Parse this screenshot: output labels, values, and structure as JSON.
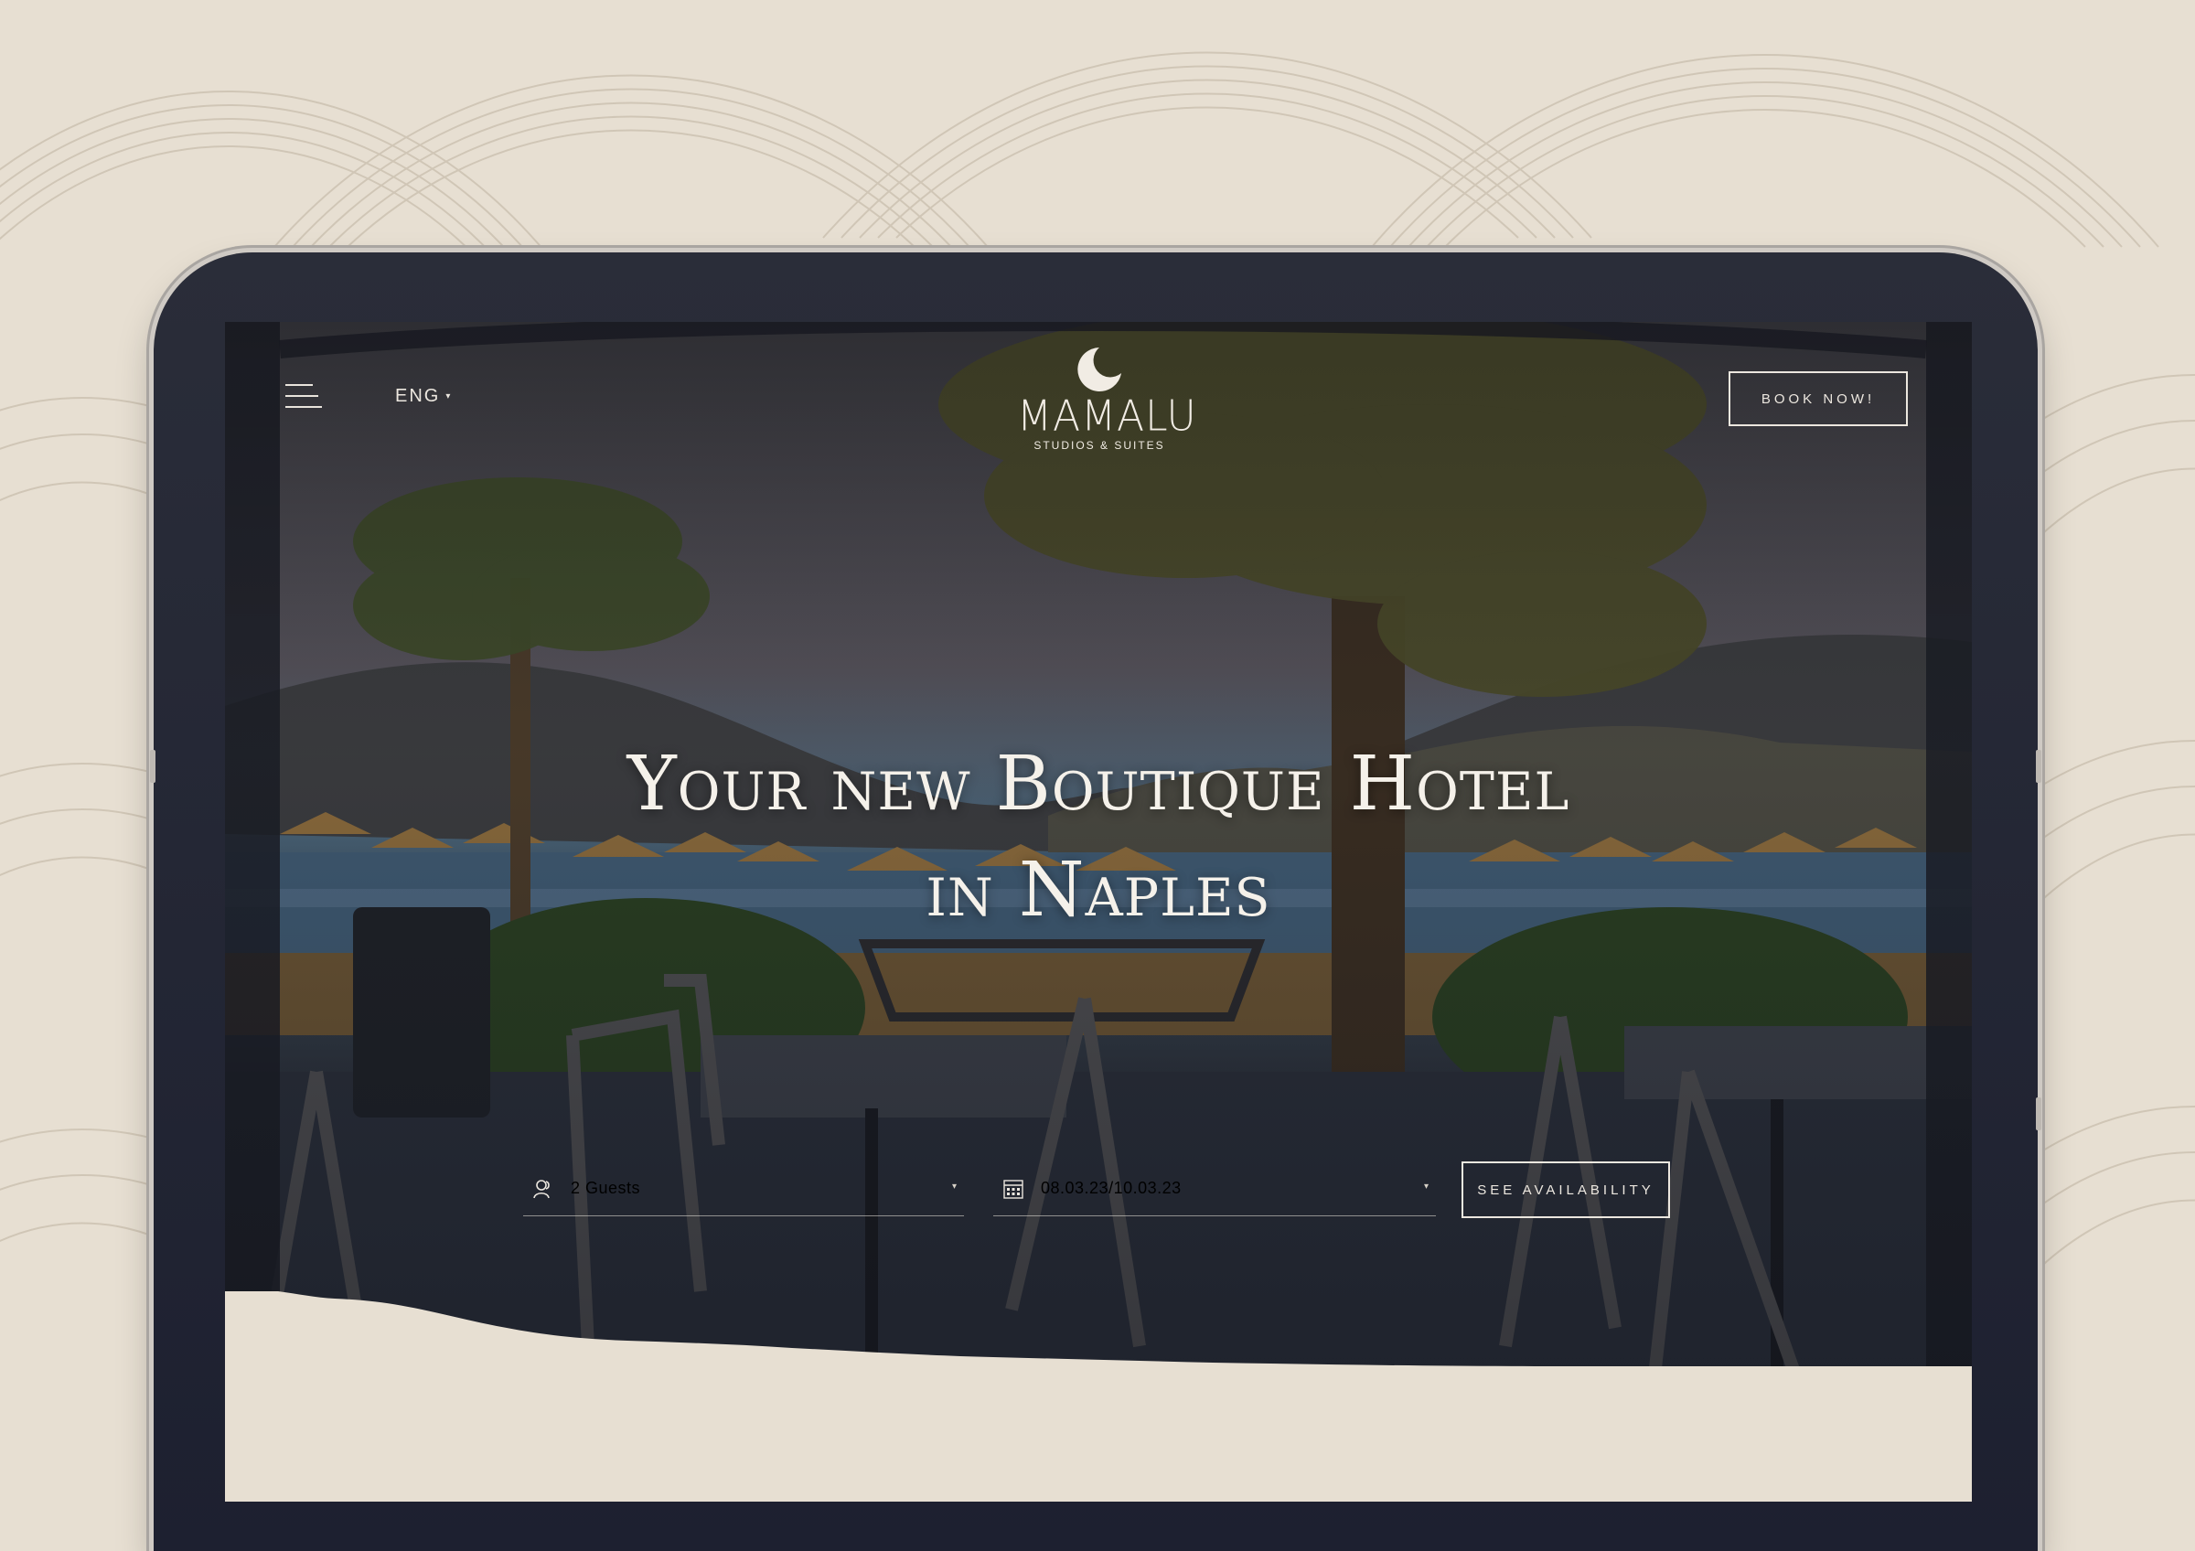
{
  "header": {
    "menu_icon": "hamburger-menu-icon",
    "language": "ENG",
    "logo": {
      "name": "MAMALU",
      "tagline": "STUDIOS & SUITES",
      "icon": "crescent-moon-icon"
    },
    "book_button": "BOOK NOW!"
  },
  "hero": {
    "headline_line1": "Your new Boutique Hotel",
    "headline_line2": "in Naples"
  },
  "booking": {
    "guests": {
      "icon": "user-icon",
      "value": "2 Guests"
    },
    "dates": {
      "icon": "calendar-icon",
      "value": "08.03.23/10.03.23"
    },
    "submit": "SEE AVAILABILITY"
  },
  "colors": {
    "background": "#e7dfd2",
    "tablet_bezel": "#23263a",
    "text_light": "#ece7df",
    "pattern_line": "#cfc5b5"
  }
}
